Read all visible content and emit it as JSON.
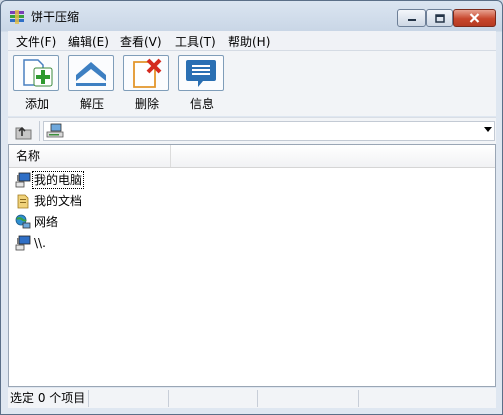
{
  "window": {
    "title": "饼干压缩"
  },
  "menu": [
    "文件(F)",
    "编辑(E)",
    "查看(V)",
    "工具(T)",
    "帮助(H)"
  ],
  "toolbar": {
    "add_label": "添加",
    "extract_label": "解压",
    "delete_label": "删除",
    "info_label": "信息"
  },
  "address": {
    "value": ""
  },
  "columns": {
    "name": "名称"
  },
  "items": [
    {
      "label": "我的电脑",
      "icon": "computer-icon"
    },
    {
      "label": "我的文档",
      "icon": "documents-folder-icon"
    },
    {
      "label": "网络",
      "icon": "network-icon"
    },
    {
      "label": "\\\\.",
      "icon": "computer-icon"
    }
  ],
  "status": {
    "selection": "选定 0 个项目"
  },
  "colors": {
    "title_bg": "#dbe5f1",
    "close_red": "#c7462c",
    "accent_blue": "#2a6fb3"
  }
}
